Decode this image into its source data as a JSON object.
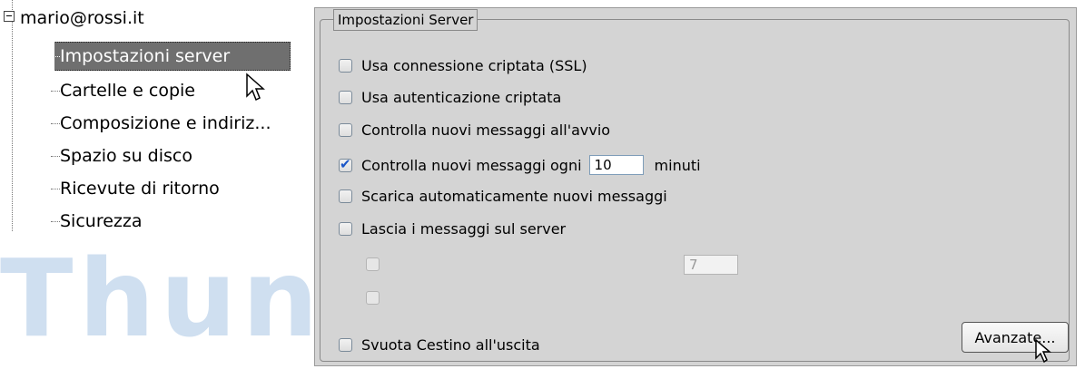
{
  "tree": {
    "account": "mario@rossi.it",
    "items": [
      {
        "label": "Impostazioni server",
        "selected": true
      },
      {
        "label": "Cartelle e copie",
        "selected": false
      },
      {
        "label": "Composizione e indiriz...",
        "selected": false
      },
      {
        "label": "Spazio su disco",
        "selected": false
      },
      {
        "label": "Ricevute di ritorno",
        "selected": false
      },
      {
        "label": "Sicurezza",
        "selected": false
      }
    ]
  },
  "watermark": "Thund",
  "panel": {
    "group_title": "Impostazioni Server",
    "options": [
      {
        "label": "Usa connessione criptata (SSL)",
        "checked": false
      },
      {
        "label": "Usa autenticazione criptata",
        "checked": false
      },
      {
        "label": "Controlla nuovi messaggi all'avvio",
        "checked": false
      },
      {
        "label": "Controlla nuovi messaggi ogni",
        "checked": true,
        "value": "10",
        "suffix": "minuti"
      },
      {
        "label": "Scarica automaticamente nuovi messaggi",
        "checked": false
      },
      {
        "label": "Lascia i messaggi sul server",
        "checked": false
      }
    ],
    "disabled_value": "7",
    "empty_trash_label": "Svuota Cestino all'uscita",
    "advanced_button": "Avanzate..."
  },
  "colors": {
    "selection": "#6f6f6f",
    "panel_bg": "#d4d4d4",
    "check": "#1a56c8",
    "watermark": "#cfdff0"
  }
}
